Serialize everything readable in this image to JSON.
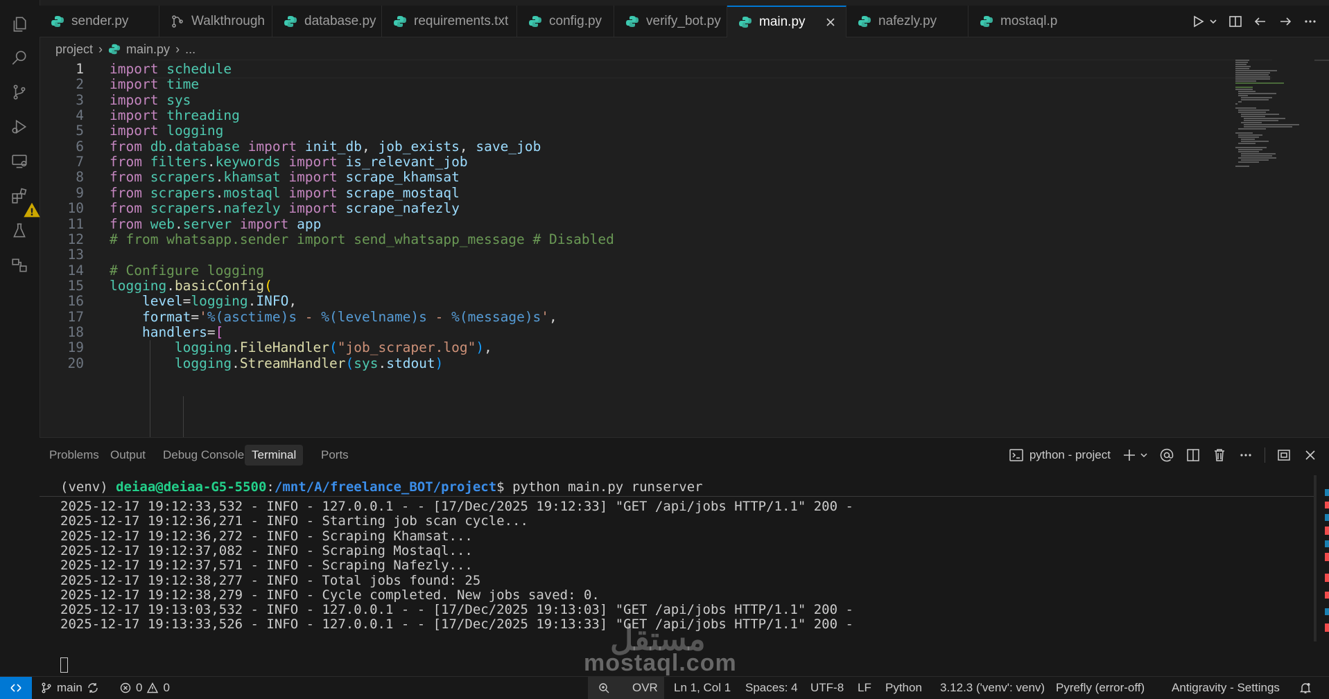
{
  "tabs": [
    {
      "label": "sender.py",
      "type": "python"
    },
    {
      "label": "Walkthrough",
      "type": "walkthrough"
    },
    {
      "label": "database.py",
      "type": "python"
    },
    {
      "label": "requirements.txt",
      "type": "python"
    },
    {
      "label": "config.py",
      "type": "python"
    },
    {
      "label": "verify_bot.py",
      "type": "python"
    },
    {
      "label": "main.py",
      "type": "python",
      "active": true
    },
    {
      "label": "nafezly.py",
      "type": "python"
    },
    {
      "label": "mostaql.p",
      "type": "python"
    }
  ],
  "breadcrumb": {
    "folder": "project",
    "file": "main.py",
    "more": "..."
  },
  "editor": {
    "current_line": 1,
    "lines": [
      {
        "n": "1",
        "text": "import schedule"
      },
      {
        "n": "2",
        "text": "import time"
      },
      {
        "n": "3",
        "text": "import sys"
      },
      {
        "n": "4",
        "text": "import threading"
      },
      {
        "n": "5",
        "text": "import logging"
      },
      {
        "n": "6",
        "text": "from db.database import init_db, job_exists, save_job"
      },
      {
        "n": "7",
        "text": "from filters.keywords import is_relevant_job"
      },
      {
        "n": "8",
        "text": "from scrapers.khamsat import scrape_khamsat"
      },
      {
        "n": "9",
        "text": "from scrapers.mostaql import scrape_mostaql"
      },
      {
        "n": "10",
        "text": "from scrapers.nafezly import scrape_nafezly"
      },
      {
        "n": "11",
        "text": "from web.server import app"
      },
      {
        "n": "12",
        "text": "# from whatsapp.sender import send_whatsapp_message # Disabled"
      },
      {
        "n": "13",
        "text": ""
      },
      {
        "n": "14",
        "text": "# Configure logging"
      },
      {
        "n": "15",
        "text": "logging.basicConfig("
      },
      {
        "n": "16",
        "text": "    level=logging.INFO,"
      },
      {
        "n": "17",
        "text": "    format='%(asctime)s - %(levelname)s - %(message)s',"
      },
      {
        "n": "18",
        "text": "    handlers=["
      },
      {
        "n": "19",
        "text": "        logging.FileHandler(\"job_scraper.log\"),"
      },
      {
        "n": "20",
        "text": "        logging.StreamHandler(sys.stdout)"
      }
    ]
  },
  "panel": {
    "tabs": [
      "Problems",
      "Output",
      "Debug Console",
      "Terminal",
      "Ports"
    ],
    "active_tab": "Terminal",
    "terminal_name": "python - project"
  },
  "terminal": {
    "prompt": {
      "venv": "(venv) ",
      "user_host": "deiaa@deiaa-G5-5500",
      "sep": ":",
      "path": "/mnt/A/freelance_BOT/project",
      "dollar": "$ ",
      "command": "python main.py runserver"
    },
    "lines": [
      "2025-12-17 19:12:33,532 - INFO - 127.0.0.1 - - [17/Dec/2025 19:12:33] \"GET /api/jobs HTTP/1.1\" 200 -",
      "2025-12-17 19:12:36,271 - INFO - Starting job scan cycle...",
      "2025-12-17 19:12:36,272 - INFO - Scraping Khamsat...",
      "2025-12-17 19:12:37,082 - INFO - Scraping Mostaql...",
      "2025-12-17 19:12:37,571 - INFO - Scraping Nafezly...",
      "2025-12-17 19:12:38,277 - INFO - Total jobs found: 25",
      "2025-12-17 19:12:38,279 - INFO - Cycle completed. New jobs saved: 0.",
      "2025-12-17 19:13:03,532 - INFO - 127.0.0.1 - - [17/Dec/2025 19:13:03] \"GET /api/jobs HTTP/1.1\" 200 -",
      "2025-12-17 19:13:33,526 - INFO - 127.0.0.1 - - [17/Dec/2025 19:13:33] \"GET /api/jobs HTTP/1.1\" 200 -"
    ]
  },
  "status": {
    "branch": "main",
    "errors": "0",
    "warnings": "0",
    "ovr": "OVR",
    "position": "Ln 1, Col 1",
    "spaces": "Spaces: 4",
    "encoding": "UTF-8",
    "eol": "LF",
    "language": "Python",
    "interpreter": "3.12.3 ('venv': venv)",
    "pyrefly": "Pyrefly (error-off)",
    "settings": "Antigravity - Settings"
  },
  "watermark": {
    "latin": "mostaql.com",
    "arabic": "مستقل"
  },
  "colors": {
    "accent": "#0078d4",
    "python_icon": "#3dc9b0",
    "editor_bg": "#1f1f1f",
    "chrome_bg": "#181818"
  }
}
